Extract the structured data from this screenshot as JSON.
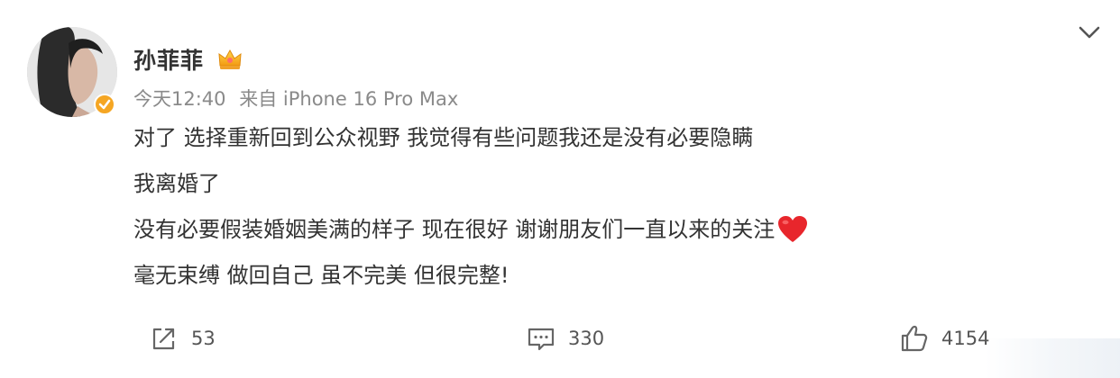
{
  "post": {
    "author": {
      "name": "孙菲菲"
    },
    "meta": {
      "time": "今天12:40",
      "source": "来自 iPhone 16 Pro Max"
    },
    "lines": [
      "对了 选择重新回到公众视野 我觉得有些问题我还是没有必要隐瞒",
      "我离婚了",
      "没有必要假装婚姻美满的样子 现在很好 谢谢朋友们一直以来的关注",
      "毫无束缚 做回自己 虽不完美 但很完整!"
    ],
    "actions": {
      "repost_count": "53",
      "comment_count": "330",
      "like_count": "4154"
    },
    "colors": {
      "text": "#333333",
      "meta": "#8a8a8a",
      "verified": "#f5a623",
      "heart": "#e8262c"
    },
    "icons": {
      "badge": "crown-icon",
      "verified": "verified-badge-icon",
      "menu": "chevron-down-icon",
      "repost": "repost-icon",
      "comment": "comment-icon",
      "like": "thumbs-up-icon",
      "emoji": "heart-icon"
    }
  }
}
